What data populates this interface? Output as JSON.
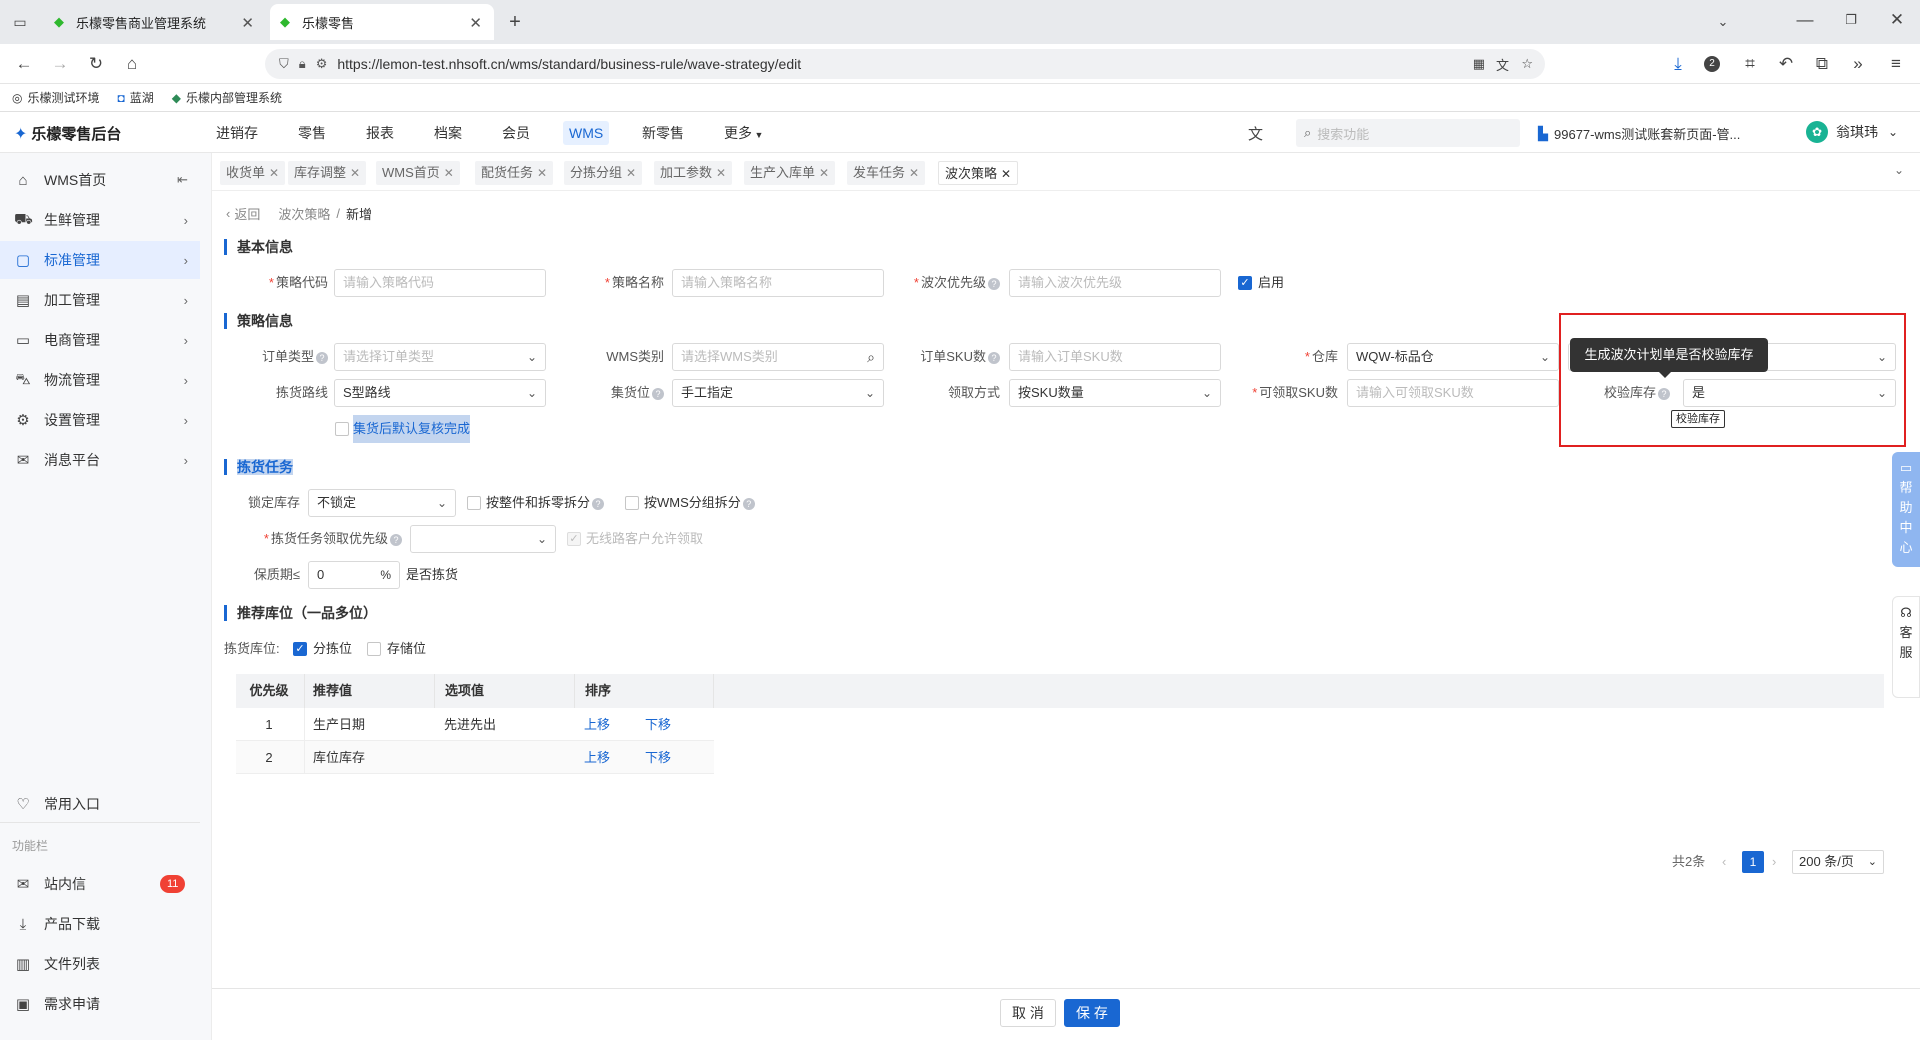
{
  "browser": {
    "tabs": [
      {
        "title": "乐檬零售商业管理系统"
      },
      {
        "title": "乐檬零售"
      }
    ],
    "url": "https://lemon-test.nhsoft.cn/wms/standard/business-rule/wave-strategy/edit",
    "bookmarks": [
      "乐檬测试环境",
      "蓝湖",
      "乐檬内部管理系统"
    ],
    "ext_badge": "2"
  },
  "app": {
    "logo": "乐檬零售后台",
    "menus": [
      "进销存",
      "零售",
      "报表",
      "档案",
      "会员",
      "WMS",
      "新零售",
      "更多"
    ],
    "search_placeholder": "搜索功能",
    "account": "99677-wms测试账套新页面-管...",
    "user": "翁琪玮"
  },
  "sidebar": {
    "items": [
      {
        "label": "WMS首页"
      },
      {
        "label": "生鲜管理"
      },
      {
        "label": "标准管理"
      },
      {
        "label": "加工管理"
      },
      {
        "label": "电商管理"
      },
      {
        "label": "物流管理"
      },
      {
        "label": "设置管理"
      },
      {
        "label": "消息平台"
      }
    ],
    "favorites": "常用入口",
    "section": "功能栏",
    "bottom": [
      {
        "label": "站内信",
        "badge": "11"
      },
      {
        "label": "产品下载"
      },
      {
        "label": "文件列表"
      },
      {
        "label": "需求申请"
      }
    ]
  },
  "page_tabs": [
    "收货单",
    "库存调整",
    "WMS首页",
    "配货任务",
    "分拣分组",
    "加工参数",
    "生产入库单",
    "发车任务",
    "波次策略"
  ],
  "breadcrumb": {
    "back": "返回",
    "parent": "波次策略",
    "sep": "/",
    "current": "新增"
  },
  "basic": {
    "title": "基本信息",
    "code_label": "策略代码",
    "code_ph": "请输入策略代码",
    "name_label": "策略名称",
    "name_ph": "请输入策略名称",
    "prio_label": "波次优先级",
    "prio_ph": "请输入波次优先级",
    "enable_label": "启用"
  },
  "strategy": {
    "title": "策略信息",
    "order_type_label": "订单类型",
    "order_type_ph": "请选择订单类型",
    "wms_cat_label": "WMS类别",
    "wms_cat_ph": "请选择WMS类别",
    "sku_label": "订单SKU数",
    "sku_ph": "请输入订单SKU数",
    "warehouse_label": "仓库",
    "warehouse_value": "WQW-标品仓",
    "route_label": "拣货路线",
    "route_value": "S型路线",
    "collect_label": "集货位",
    "collect_value": "手工指定",
    "fetch_label": "领取方式",
    "fetch_value": "按SKU数量",
    "fetch_sku_label": "可领取SKU数",
    "fetch_sku_ph": "请输入可领取SKU数",
    "check_label": "校验库存",
    "check_value": "是",
    "tooltip": "生成波次计划单是否校验库存",
    "small_tip": "校验库存",
    "auto_check": "集货后默认复核完成"
  },
  "picking": {
    "title": "拣货任务",
    "lock_label": "锁定库存",
    "lock_value": "不锁定",
    "split1": "按整件和拆零拆分",
    "split2": "按WMS分组拆分",
    "priority_label": "拣货任务领取优先级",
    "no_route": "无线路客户允许领取",
    "shelf_label": "保质期≤",
    "shelf_value": "0",
    "shelf_unit": "%",
    "shelf_suffix": "是否拣货"
  },
  "recommend": {
    "title": "推荐库位（一品多位）",
    "loc_label": "拣货库位:",
    "opt1": "分拣位",
    "opt2": "存储位",
    "headers": [
      "优先级",
      "推荐值",
      "选项值",
      "排序"
    ],
    "rows": [
      {
        "priority": "1",
        "value": "生产日期",
        "option": "先进先出",
        "up": "上移",
        "down": "下移"
      },
      {
        "priority": "2",
        "value": "库位库存",
        "option": "",
        "up": "上移",
        "down": "下移"
      }
    ]
  },
  "pager": {
    "total": "共2条",
    "page": "1",
    "size": "200 条/页"
  },
  "footer": {
    "cancel": "取 消",
    "save": "保 存"
  },
  "help_widget": {
    "help": "帮助中心",
    "service": "客服"
  },
  "colors": {
    "primary": "#1967d2",
    "danger": "#f04134",
    "highlight_box": "#e02020"
  }
}
